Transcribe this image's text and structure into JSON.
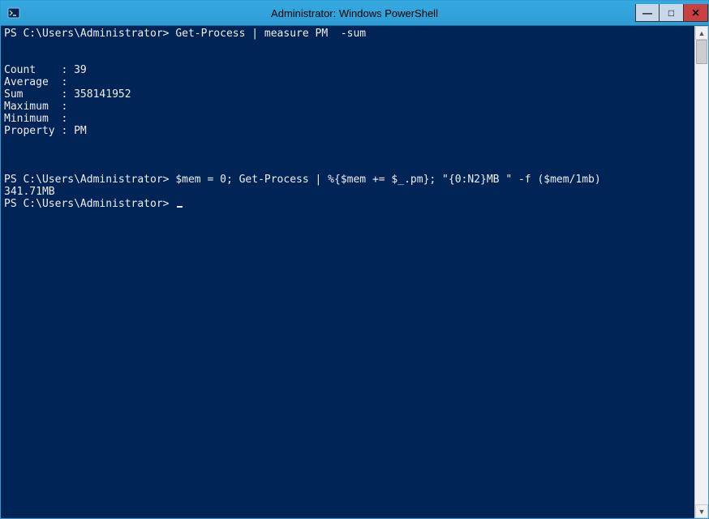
{
  "window": {
    "title": "Administrator: Windows PowerShell",
    "icon_name": "powershell-icon"
  },
  "controls": {
    "minimize_glyph": "—",
    "maximize_glyph": "□",
    "close_glyph": "✕"
  },
  "console": {
    "prompt": "PS C:\\Users\\Administrator>",
    "line1_cmd": "Get-Process | measure PM  -sum",
    "output_block": {
      "count_label": "Count    :",
      "count_value": "39",
      "average_label": "Average  :",
      "average_value": "",
      "sum_label": "Sum      :",
      "sum_value": "358141952",
      "maximum_label": "Maximum  :",
      "maximum_value": "",
      "minimum_label": "Minimum  :",
      "minimum_value": "",
      "property_label": "Property :",
      "property_value": "PM"
    },
    "line2_cmd": "$mem = 0; Get-Process | %{$mem += $_.pm}; \"{0:N2}MB \" -f ($mem/1mb)",
    "line2_output": "341.71MB"
  },
  "scrollbar": {
    "up_glyph": "▲",
    "down_glyph": "▼"
  },
  "colors": {
    "console_bg": "#012456",
    "console_fg": "#eeedf0",
    "titlebar_bg": "#2e9dd6",
    "close_bg": "#c84040"
  }
}
